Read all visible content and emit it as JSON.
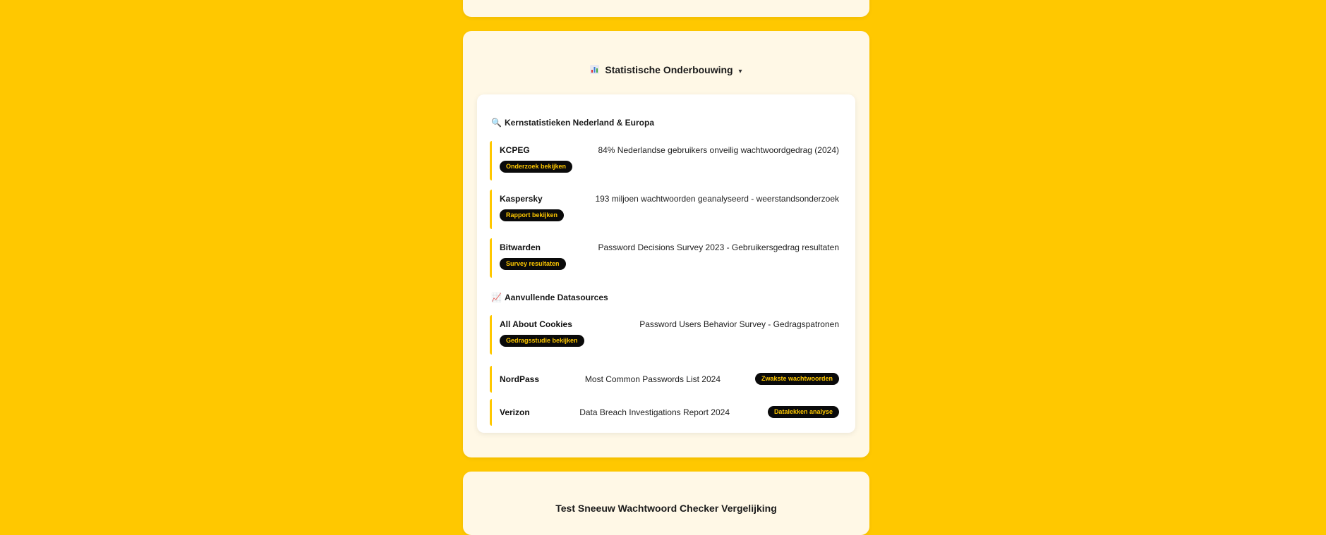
{
  "section": {
    "title": "Statistische Onderbouwing",
    "caret": "▾",
    "icon": "bar-chart-icon"
  },
  "groups": [
    {
      "icon": "🔍",
      "icon_name": "magnifier-icon",
      "heading": "Kernstatistieken Nederland & Europa",
      "entries": [
        {
          "name": "KCPEG",
          "description": "84% Nederlandse gebruikers onveilig wachtwoordgedrag (2024)",
          "badge": "Onderzoek bekijken"
        },
        {
          "name": "Kaspersky",
          "description": "193 miljoen wachtwoorden geanalyseerd - weerstandsonderzoek",
          "badge": "Rapport bekijken"
        },
        {
          "name": "Bitwarden",
          "description": "Password Decisions Survey 2023 - Gebruikersgedrag resultaten",
          "badge": "Survey resultaten"
        }
      ]
    },
    {
      "icon": "📈",
      "icon_name": "trend-chart-icon",
      "heading": "Aanvullende Datasources",
      "entries": [
        {
          "name": "All About Cookies",
          "description": "Password Users Behavior Survey - Gedragspatronen",
          "badge": "Gedragsstudie bekijken"
        },
        {
          "name": "NordPass",
          "description": "Most Common Passwords List 2024",
          "badge": "Zwakste wachtwoorden"
        },
        {
          "name": "Verizon",
          "description": "Data Breach Investigations Report 2024",
          "badge": "Datalekken analyse"
        }
      ]
    }
  ],
  "next_section": {
    "title": "Test Sneeuw Wachtwoord Checker Vergelijking"
  },
  "colors": {
    "background": "#FFC800",
    "card": "#FFF8E6",
    "badge_bg": "#0a0a0a",
    "badge_text": "#FFC800",
    "accent_border": "#FFC800"
  }
}
